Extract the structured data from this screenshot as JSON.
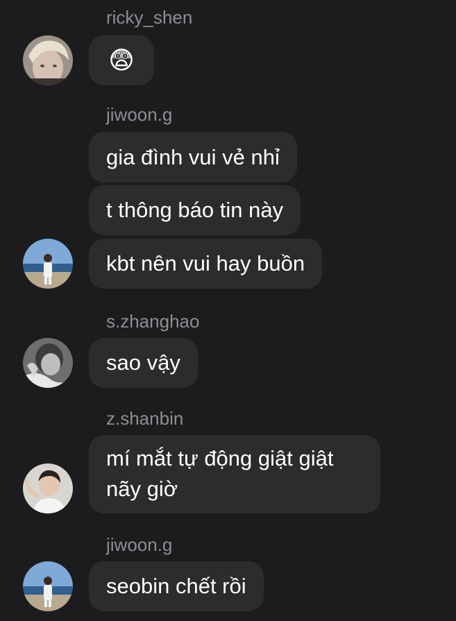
{
  "messages": [
    {
      "sender": "ricky_shen",
      "avatar": "avatar-blonde",
      "bubbles": [
        "😨"
      ]
    },
    {
      "sender": "jiwoon.g",
      "avatar": "avatar-beach",
      "bubbles": [
        "gia đình vui vẻ nhỉ",
        "t thông báo tin này",
        "kbt nên vui hay buồn"
      ]
    },
    {
      "sender": "s.zhanghao",
      "avatar": "avatar-bw",
      "bubbles": [
        "sao vậy"
      ]
    },
    {
      "sender": "z.shanbin",
      "avatar": "avatar-pose",
      "bubbles": [
        "mí mắt tự động giật giật nãy giờ"
      ]
    },
    {
      "sender": "jiwoon.g",
      "avatar": "avatar-beach",
      "bubbles": [
        "seobin chết rồi"
      ]
    }
  ]
}
